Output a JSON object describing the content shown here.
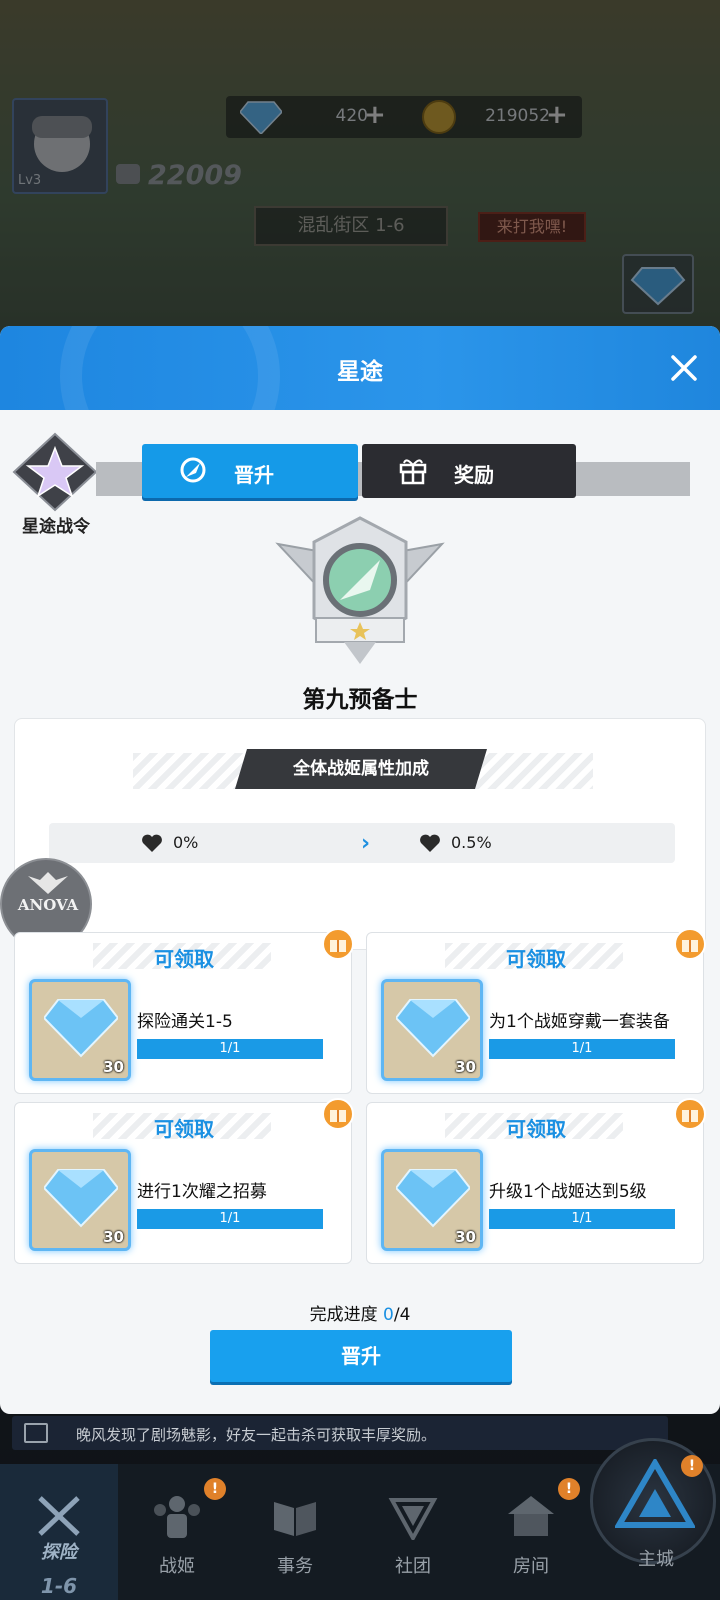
{
  "background": {
    "gem_count": "420",
    "coin_count": "219052",
    "player_level": "Lv3",
    "power": "22009",
    "stage_label": "混乱街区 1-6",
    "hit_me_label": "来打我嘿!"
  },
  "modal": {
    "title": "星途",
    "pass_label": "星途战令",
    "tabs": {
      "promote": "晋升",
      "reward": "奖励"
    },
    "rank_name": "第九预备士",
    "attr": {
      "title": "全体战姬属性加成",
      "from_value": "0%",
      "to_value": "0.5%"
    },
    "watermark": "ANOVA",
    "tasks": [
      {
        "status": "可领取",
        "desc": "探险通关1-5",
        "progress": "1/1",
        "reward_count": "30"
      },
      {
        "status": "可领取",
        "desc": "为1个战姬穿戴一套装备",
        "progress": "1/1",
        "reward_count": "30"
      },
      {
        "status": "可领取",
        "desc": "进行1次耀之招募",
        "progress": "1/1",
        "reward_count": "30"
      },
      {
        "status": "可领取",
        "desc": "升级1个战姬达到5级",
        "progress": "1/1",
        "reward_count": "30"
      }
    ],
    "progress_label": "完成进度",
    "progress_current": "0",
    "progress_total": "/4",
    "promote_button": "晋升"
  },
  "marquee": "晚风发现了剧场魅影，好友一起击杀可获取丰厚奖励。",
  "nav": {
    "explore": "探险",
    "explore_sub": "1-6",
    "girls": "战姬",
    "affairs": "事务",
    "guild": "社团",
    "room": "房间",
    "city": "主城",
    "badge": "!"
  },
  "colors": {
    "accent": "#1a9ae6",
    "header": "#2b95ea",
    "dark_tab": "#2b2c31"
  }
}
